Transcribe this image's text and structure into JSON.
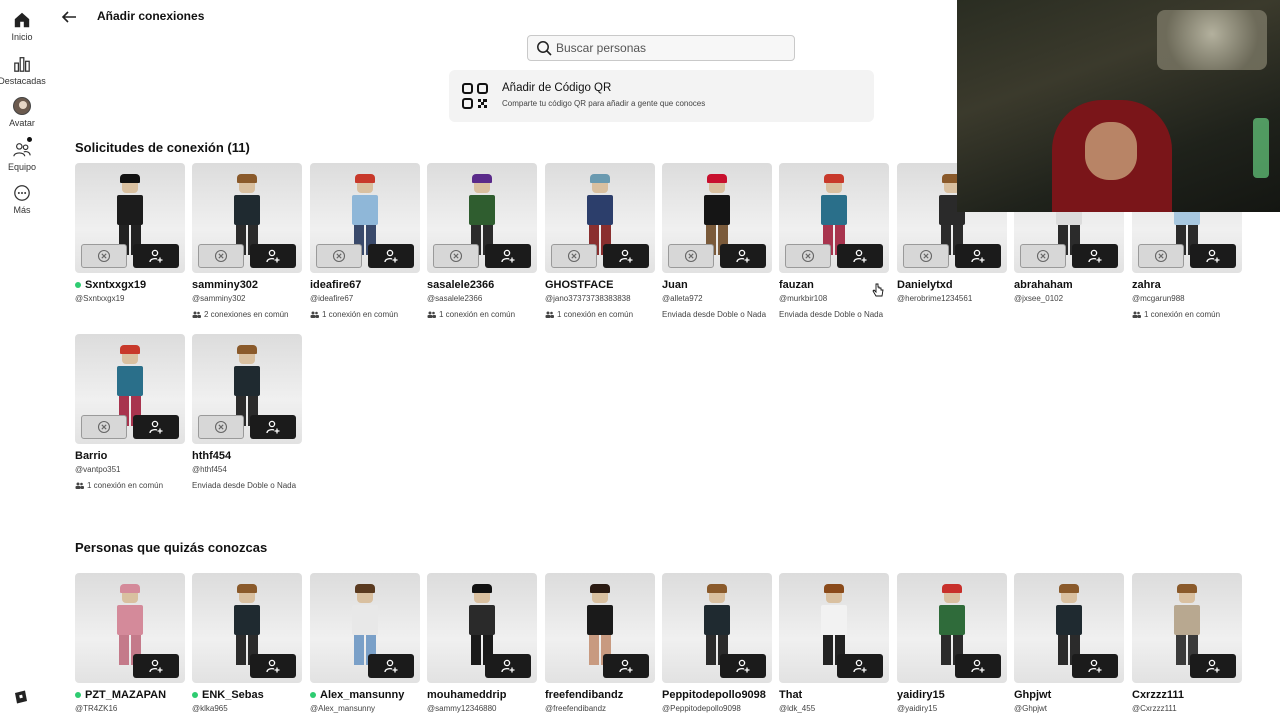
{
  "sidebar": {
    "items": [
      {
        "label": "Inicio",
        "icon": "home-icon"
      },
      {
        "label": "Destacadas",
        "icon": "charts-icon"
      },
      {
        "label": "Avatar",
        "icon": "avatar-icon"
      },
      {
        "label": "Equipo",
        "icon": "team-icon"
      },
      {
        "label": "Más",
        "icon": "more-icon"
      }
    ]
  },
  "header": {
    "title": "Añadir conexiones"
  },
  "search": {
    "placeholder": "Buscar personas"
  },
  "qr": {
    "title": "Añadir de Código QR",
    "subtitle": "Comparte tu código QR para añadir a gente que conoces"
  },
  "requests": {
    "title": "Solicitudes de conexión (11)",
    "cards": [
      {
        "name": "Sxntxxgx19",
        "handle": "@Sxntxxgx19",
        "online": true,
        "note": "",
        "mutual": false,
        "hair": "#111111",
        "torso": "#1c1c1c",
        "legs": "#222222"
      },
      {
        "name": "samminy302",
        "handle": "@samminy302",
        "online": false,
        "note": "2 conexiones en común",
        "mutual": true,
        "hair": "#8a5a2b",
        "torso": "#1f2a30",
        "legs": "#2b2b2b"
      },
      {
        "name": "ideafire67",
        "handle": "@ideafire67",
        "online": false,
        "note": "1 conexión en común",
        "mutual": true,
        "hair": "#c8392b",
        "torso": "#8fb7d8",
        "legs": "#3a4a6b"
      },
      {
        "name": "sasalele2366",
        "handle": "@sasalele2366",
        "online": false,
        "note": "1 conexión en común",
        "mutual": true,
        "hair": "#5a2a8a",
        "torso": "#2f5d2f",
        "legs": "#2b2b2b"
      },
      {
        "name": "GHOSTFACE",
        "handle": "@jano37373738383838",
        "online": false,
        "note": "1 conexión en común",
        "mutual": true,
        "hair": "#6a9ab0",
        "torso": "#2c3e6b",
        "legs": "#8a2f2f"
      },
      {
        "name": "Juan",
        "handle": "@alleta972",
        "online": false,
        "note": "Enviada desde Doble o Nada",
        "mutual": false,
        "hair": "#c8102e",
        "torso": "#151515",
        "legs": "#7a5a3a"
      },
      {
        "name": "fauzan",
        "handle": "@murkbir108",
        "online": false,
        "note": "Enviada desde Doble o Nada",
        "mutual": false,
        "hair": "#c8392b",
        "torso": "#2a6f8a",
        "legs": "#a8344e"
      },
      {
        "name": "Danielytxd",
        "handle": "@herobrime1234561",
        "online": false,
        "note": "",
        "mutual": false,
        "hair": "#8a5a2b",
        "torso": "#2a2a2a",
        "legs": "#2b2b2b"
      },
      {
        "name": "abrahaham",
        "handle": "@jxsee_0102",
        "online": false,
        "note": "",
        "mutual": false,
        "hair": "#111111",
        "torso": "#dcdcdc",
        "legs": "#2b2b2b"
      },
      {
        "name": "zahra",
        "handle": "@mcgarun988",
        "online": false,
        "note": "1 conexión en común",
        "mutual": true,
        "hair": "#8a5a2b",
        "torso": "#a8c8e0",
        "legs": "#2b2b2b"
      },
      {
        "name": "Barrio",
        "handle": "@vantpo351",
        "online": false,
        "note": "1 conexión en común",
        "mutual": true,
        "hair": "#c8392b",
        "torso": "#2a6f8a",
        "legs": "#a8344e"
      },
      {
        "name": "hthf454",
        "handle": "@hthf454",
        "online": false,
        "note": "Enviada desde Doble o Nada",
        "mutual": false,
        "hair": "#8a5a2b",
        "torso": "#1f2a30",
        "legs": "#2b2b2b"
      }
    ]
  },
  "suggestions": {
    "title": "Personas que quizás conozcas",
    "cards": [
      {
        "name": "PZT_MAZAPAN",
        "handle": "@TR4ZK16",
        "online": true,
        "hair": "#d48a9a",
        "torso": "#d48a9a",
        "legs": "#c47a8a"
      },
      {
        "name": "ENK_Sebas",
        "handle": "@klka965",
        "online": true,
        "hair": "#8a5a2b",
        "torso": "#1f2a30",
        "legs": "#2b2b2b"
      },
      {
        "name": "Alex_mansunny",
        "handle": "@Alex_mansunny",
        "online": true,
        "hair": "#5a3a20",
        "torso": "#e8e8e8",
        "legs": "#7aa0c8"
      },
      {
        "name": "mouhameddrip",
        "handle": "@sammy12346880",
        "online": false,
        "hair": "#111111",
        "torso": "#2a2a2a",
        "legs": "#1a1a1a"
      },
      {
        "name": "freefendibandz",
        "handle": "@freefendibandz",
        "online": false,
        "hair": "#2a1a12",
        "torso": "#1a1a1a",
        "legs": "#c89a80"
      },
      {
        "name": "Peppitodepollo9098",
        "handle": "@Peppitodepollo9098",
        "online": false,
        "hair": "#8a5a2b",
        "torso": "#1f2a30",
        "legs": "#2b2b2b"
      },
      {
        "name": "That",
        "handle": "@ldk_455",
        "online": false,
        "hair": "#8a4a1a",
        "torso": "#f2f2f2",
        "legs": "#222222"
      },
      {
        "name": "yaidiry15",
        "handle": "@yaidiry15",
        "online": false,
        "hair": "#c8302b",
        "torso": "#2f6b3a",
        "legs": "#2b2b2b"
      },
      {
        "name": "Ghpjwt",
        "handle": "@Ghpjwt",
        "online": false,
        "hair": "#8a5a2b",
        "torso": "#1f2a30",
        "legs": "#2b2b2b"
      },
      {
        "name": "Cxrzzz111",
        "handle": "@Cxrzzz111",
        "online": false,
        "hair": "#8a5a2b",
        "torso": "#b8a890",
        "legs": "#3a3a3a"
      }
    ]
  }
}
